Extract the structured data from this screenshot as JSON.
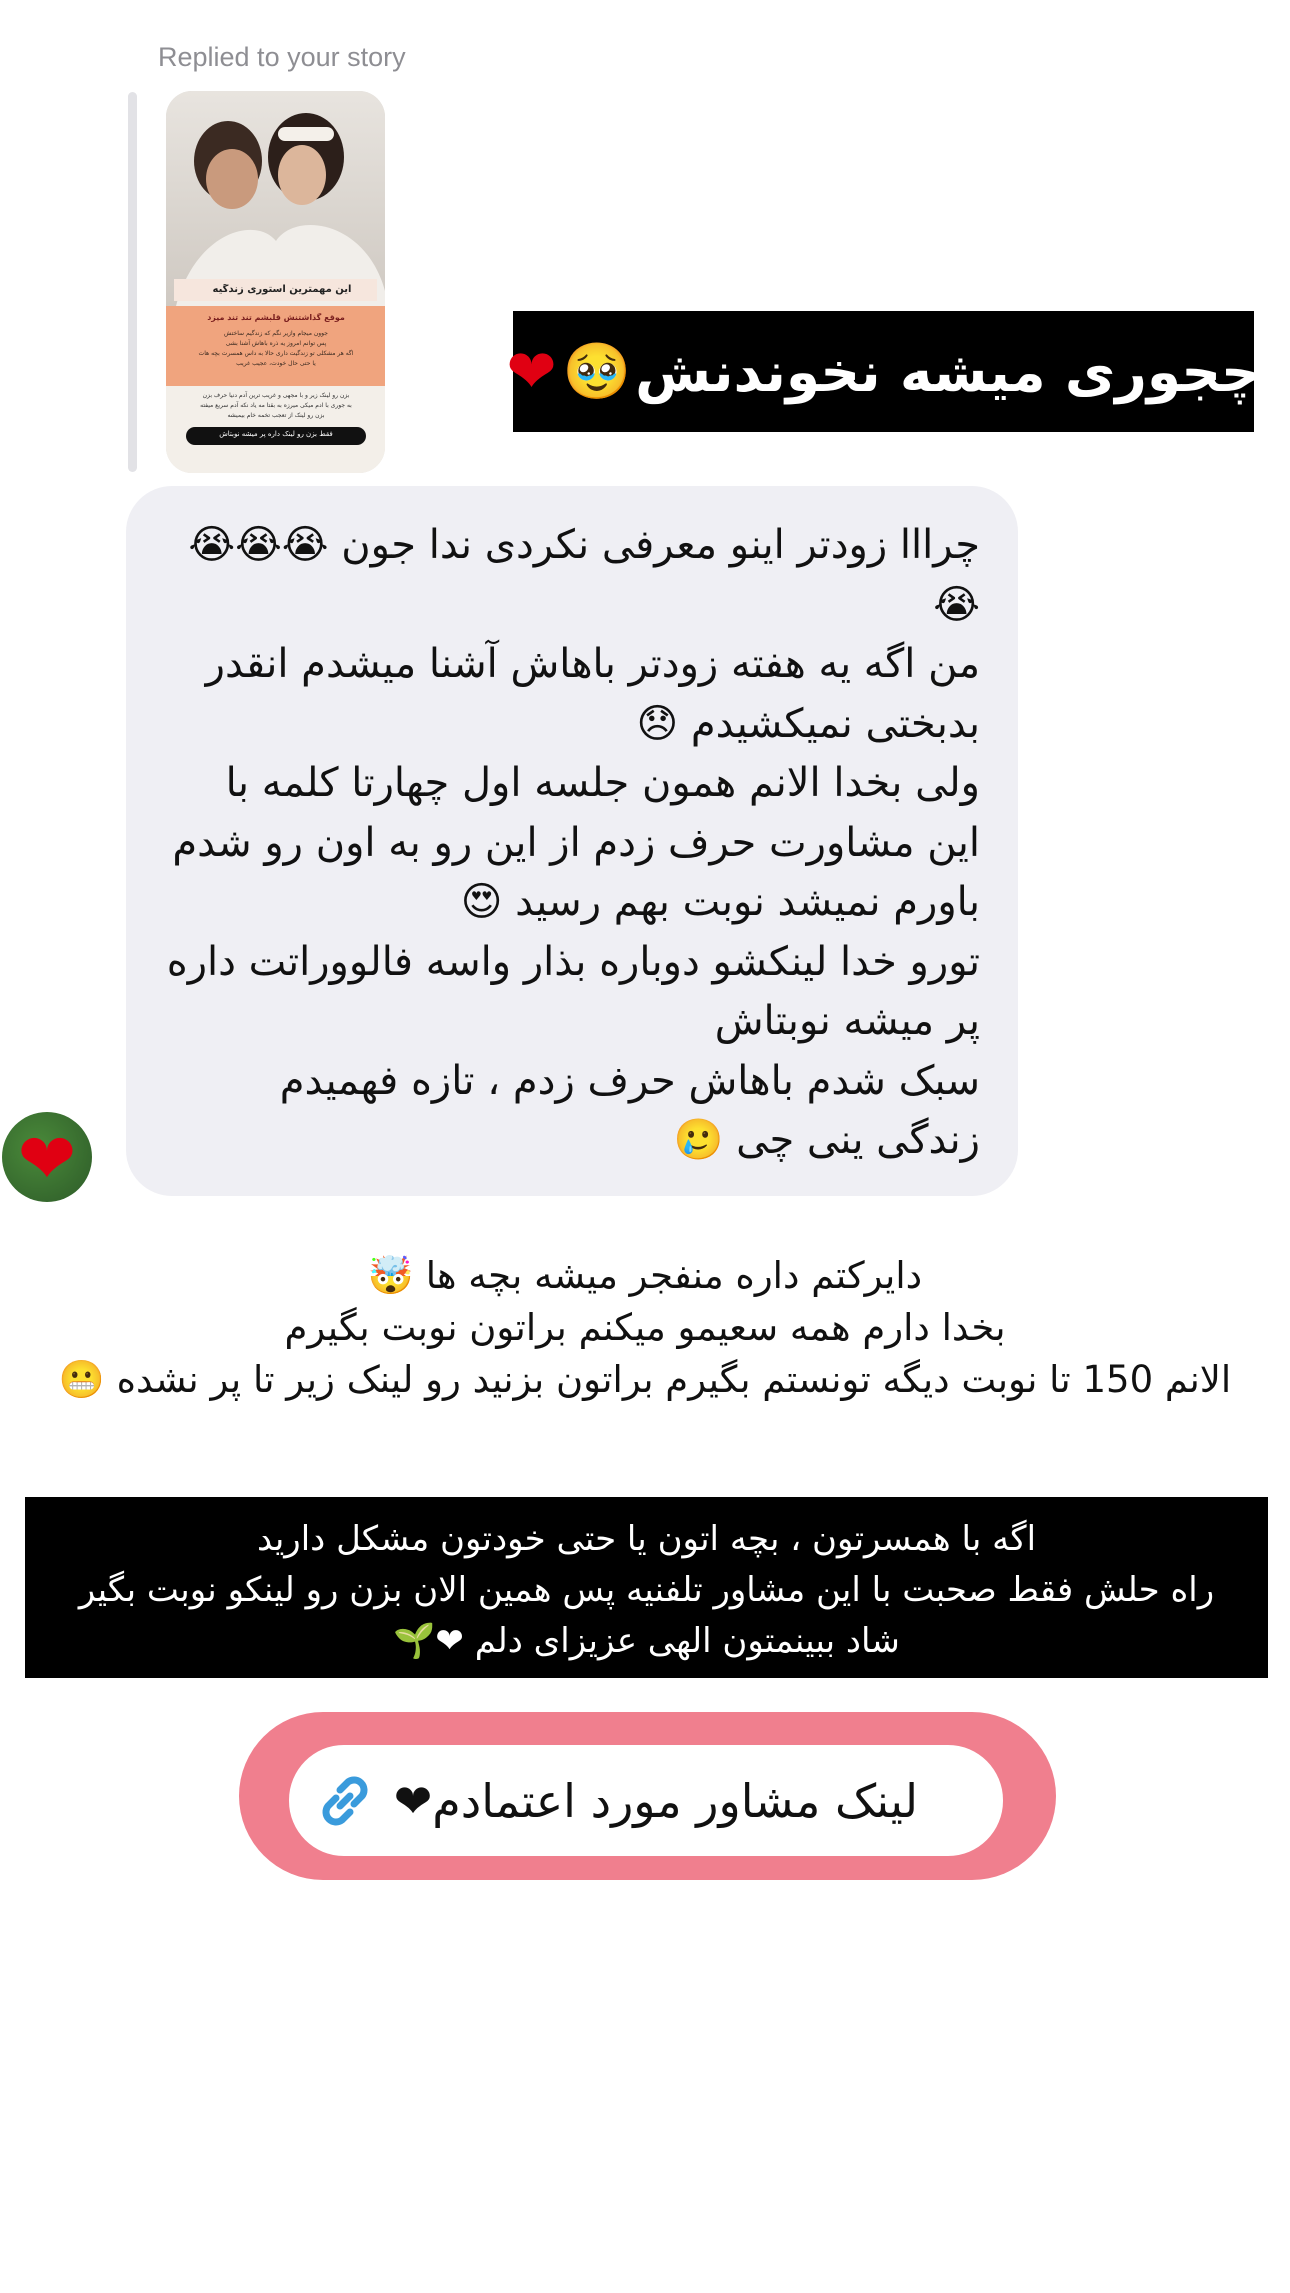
{
  "reply_header": {
    "label": "Replied to your story"
  },
  "story_thumbnail": {
    "icon": "story-image",
    "banner": "این مهمترین استوری زندگیه",
    "heading": "موقع گذاشتنش قلبشم تند تند میزد",
    "body_lines": [
      "جوون میجام وازیر نگم که زندگیم ساختش",
      "پس توانم امروز یه ذره باهاش آشنا بشی",
      "اگه هر مشکلی تو زندگیت داری حالا به داس همسرت بچه هات",
      "یا حتی حال خودت، عجیب غریب"
    ],
    "footer_lines": [
      "بزن رو لینک زیر و با مجهی و غریب ترین آدم دنیا حرف بزن",
      "به جوری با ادم میکی میرزه به بقتا مه یاد نکه آدم سریع میفته",
      "بزن رو لینک از تعجب تخمه خام بیمیشه"
    ],
    "cta": "فقط بزن رو لینک داره پر میشه نوبتاش"
  },
  "overlay_caption": {
    "text": "چجوری میشه نخوندنش",
    "emoji": "🥹",
    "heart": "❤"
  },
  "message": {
    "lines": [
      "چرااا زودتر اینو معرفی نکردی ندا جون 😭😭😭",
      "😭",
      "من اگه یه هفته زودتر باهاش آشنا میشدم انقدر",
      "بدبختی نمیکشیدم 😞",
      "ولی بخدا الانم همون جلسه اول چهارتا کلمه با",
      "این مشاورت حرف زدم از این رو به اون رو شدم",
      "باورم نمیشد نوبت بهم رسید 😍",
      "تورو خدا لینکشو دوباره بذار واسه فالووراتت داره",
      "پر میشه نوبتاش",
      "سبک شدم باهاش حرف زدم ، تازه فهمیدم",
      "زندگی ینی چی 🥲"
    ]
  },
  "reaction": {
    "icon": "heart-reaction-icon",
    "symbol": "❤"
  },
  "overlay_text": {
    "lines": [
      "دایرکتم داره منفجر میشه بچه ها 🤯",
      "بخدا دارم همه سعیمو میکنم براتون نوبت بگیرم",
      "الانم 150 تا نوبت دیگه تونستم بگیرم براتون بزنید رو لینک زیر تا پر نشده 😬"
    ]
  },
  "black_box": {
    "lines": [
      "اگه با همسرتون ، بچه اتون یا حتی خودتون مشکل دارید",
      "راه حلش فقط صحبت با این مشاور تلفنیه پس همین الان بزن رو لینکو نوبت بگیر",
      "شاد ببینمتون الهی عزیزای دلم ❤🌱"
    ]
  },
  "link_sticker": {
    "label": "لینک مشاور مورد اعتمادم❤",
    "icon": "link-icon",
    "accent": "#f07f8e",
    "icon_color": "#3a9bdc"
  }
}
